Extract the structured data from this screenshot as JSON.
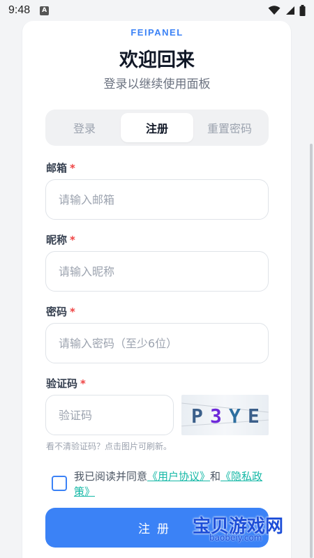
{
  "statusbar": {
    "time": "9:48",
    "a_badge": "A"
  },
  "brand": "FEIPANEL",
  "title": "欢迎回来",
  "subtitle": "登录以继续使用面板",
  "tabs": [
    {
      "label": "登录",
      "active": false
    },
    {
      "label": "注册",
      "active": true
    },
    {
      "label": "重置密码",
      "active": false
    }
  ],
  "form": {
    "email": {
      "label": "邮箱",
      "required": "*",
      "placeholder": "请输入邮箱"
    },
    "nickname": {
      "label": "昵称",
      "required": "*",
      "placeholder": "请输入昵称"
    },
    "password": {
      "label": "密码",
      "required": "*",
      "placeholder": "请输入密码（至少6位）"
    },
    "captcha": {
      "label": "验证码",
      "required": "*",
      "placeholder": "验证码",
      "image_text": "P3YE",
      "hint": "看不清验证码？点击图片可刷新。"
    }
  },
  "agreement": {
    "prefix": "我已阅读并同意",
    "user_agreement": "《用户协议》",
    "and": "和",
    "privacy_policy": "《隐私政策》"
  },
  "submit_label": "注册",
  "watermark": {
    "text": "宝贝游戏网",
    "sub": "baobeiy.com"
  },
  "colors": {
    "accent": "#3b82f6",
    "required": "#ef4444",
    "link": "#14b8a6"
  }
}
